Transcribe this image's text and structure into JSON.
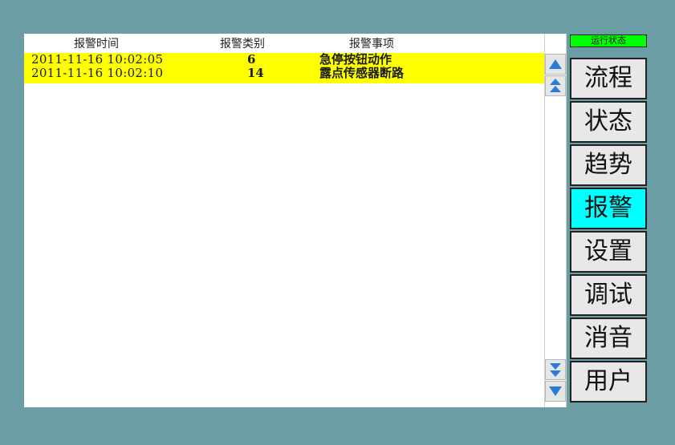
{
  "header": {
    "time": "报警时间",
    "category": "报警类别",
    "item": "报警事项"
  },
  "alarms": [
    {
      "time": "2011-11-16  10:02:05",
      "category": "6",
      "item": "急停按钮动作"
    },
    {
      "time": "2011-11-16  10:02:10",
      "category": "14",
      "item": "露点传感器断路"
    }
  ],
  "status_label": "运行状态",
  "nav": [
    {
      "label": "流程",
      "active": false
    },
    {
      "label": "状态",
      "active": false
    },
    {
      "label": "趋势",
      "active": false
    },
    {
      "label": "报警",
      "active": true
    },
    {
      "label": "设置",
      "active": false
    },
    {
      "label": "调试",
      "active": false
    },
    {
      "label": "消音",
      "active": false
    },
    {
      "label": "用户",
      "active": false
    }
  ],
  "colors": {
    "background": "#6a9ea4",
    "row_highlight": "#ffff00",
    "status": "#00ff00",
    "active_nav": "#00ffff",
    "arrow": "#2c7bd6"
  }
}
